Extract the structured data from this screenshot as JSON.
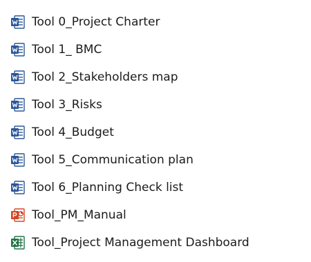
{
  "colors": {
    "word": "#2b579a",
    "powerpoint": "#d24726",
    "excel": "#217346",
    "text": "#1b1b1b"
  },
  "files": [
    {
      "name": "Tool 0_Project Charter",
      "icon": "word-document-icon"
    },
    {
      "name": "Tool 1_ BMC",
      "icon": "word-document-icon"
    },
    {
      "name": "Tool 2_Stakeholders map",
      "icon": "word-document-icon"
    },
    {
      "name": "Tool 3_Risks",
      "icon": "word-document-icon"
    },
    {
      "name": "Tool 4_Budget",
      "icon": "word-document-icon"
    },
    {
      "name": "Tool 5_Communication plan",
      "icon": "word-document-icon"
    },
    {
      "name": "Tool 6_Planning Check list",
      "icon": "word-document-icon"
    },
    {
      "name": "Tool_PM_Manual",
      "icon": "powerpoint-document-icon"
    },
    {
      "name": "Tool_Project Management Dashboard",
      "icon": "excel-document-icon"
    }
  ]
}
